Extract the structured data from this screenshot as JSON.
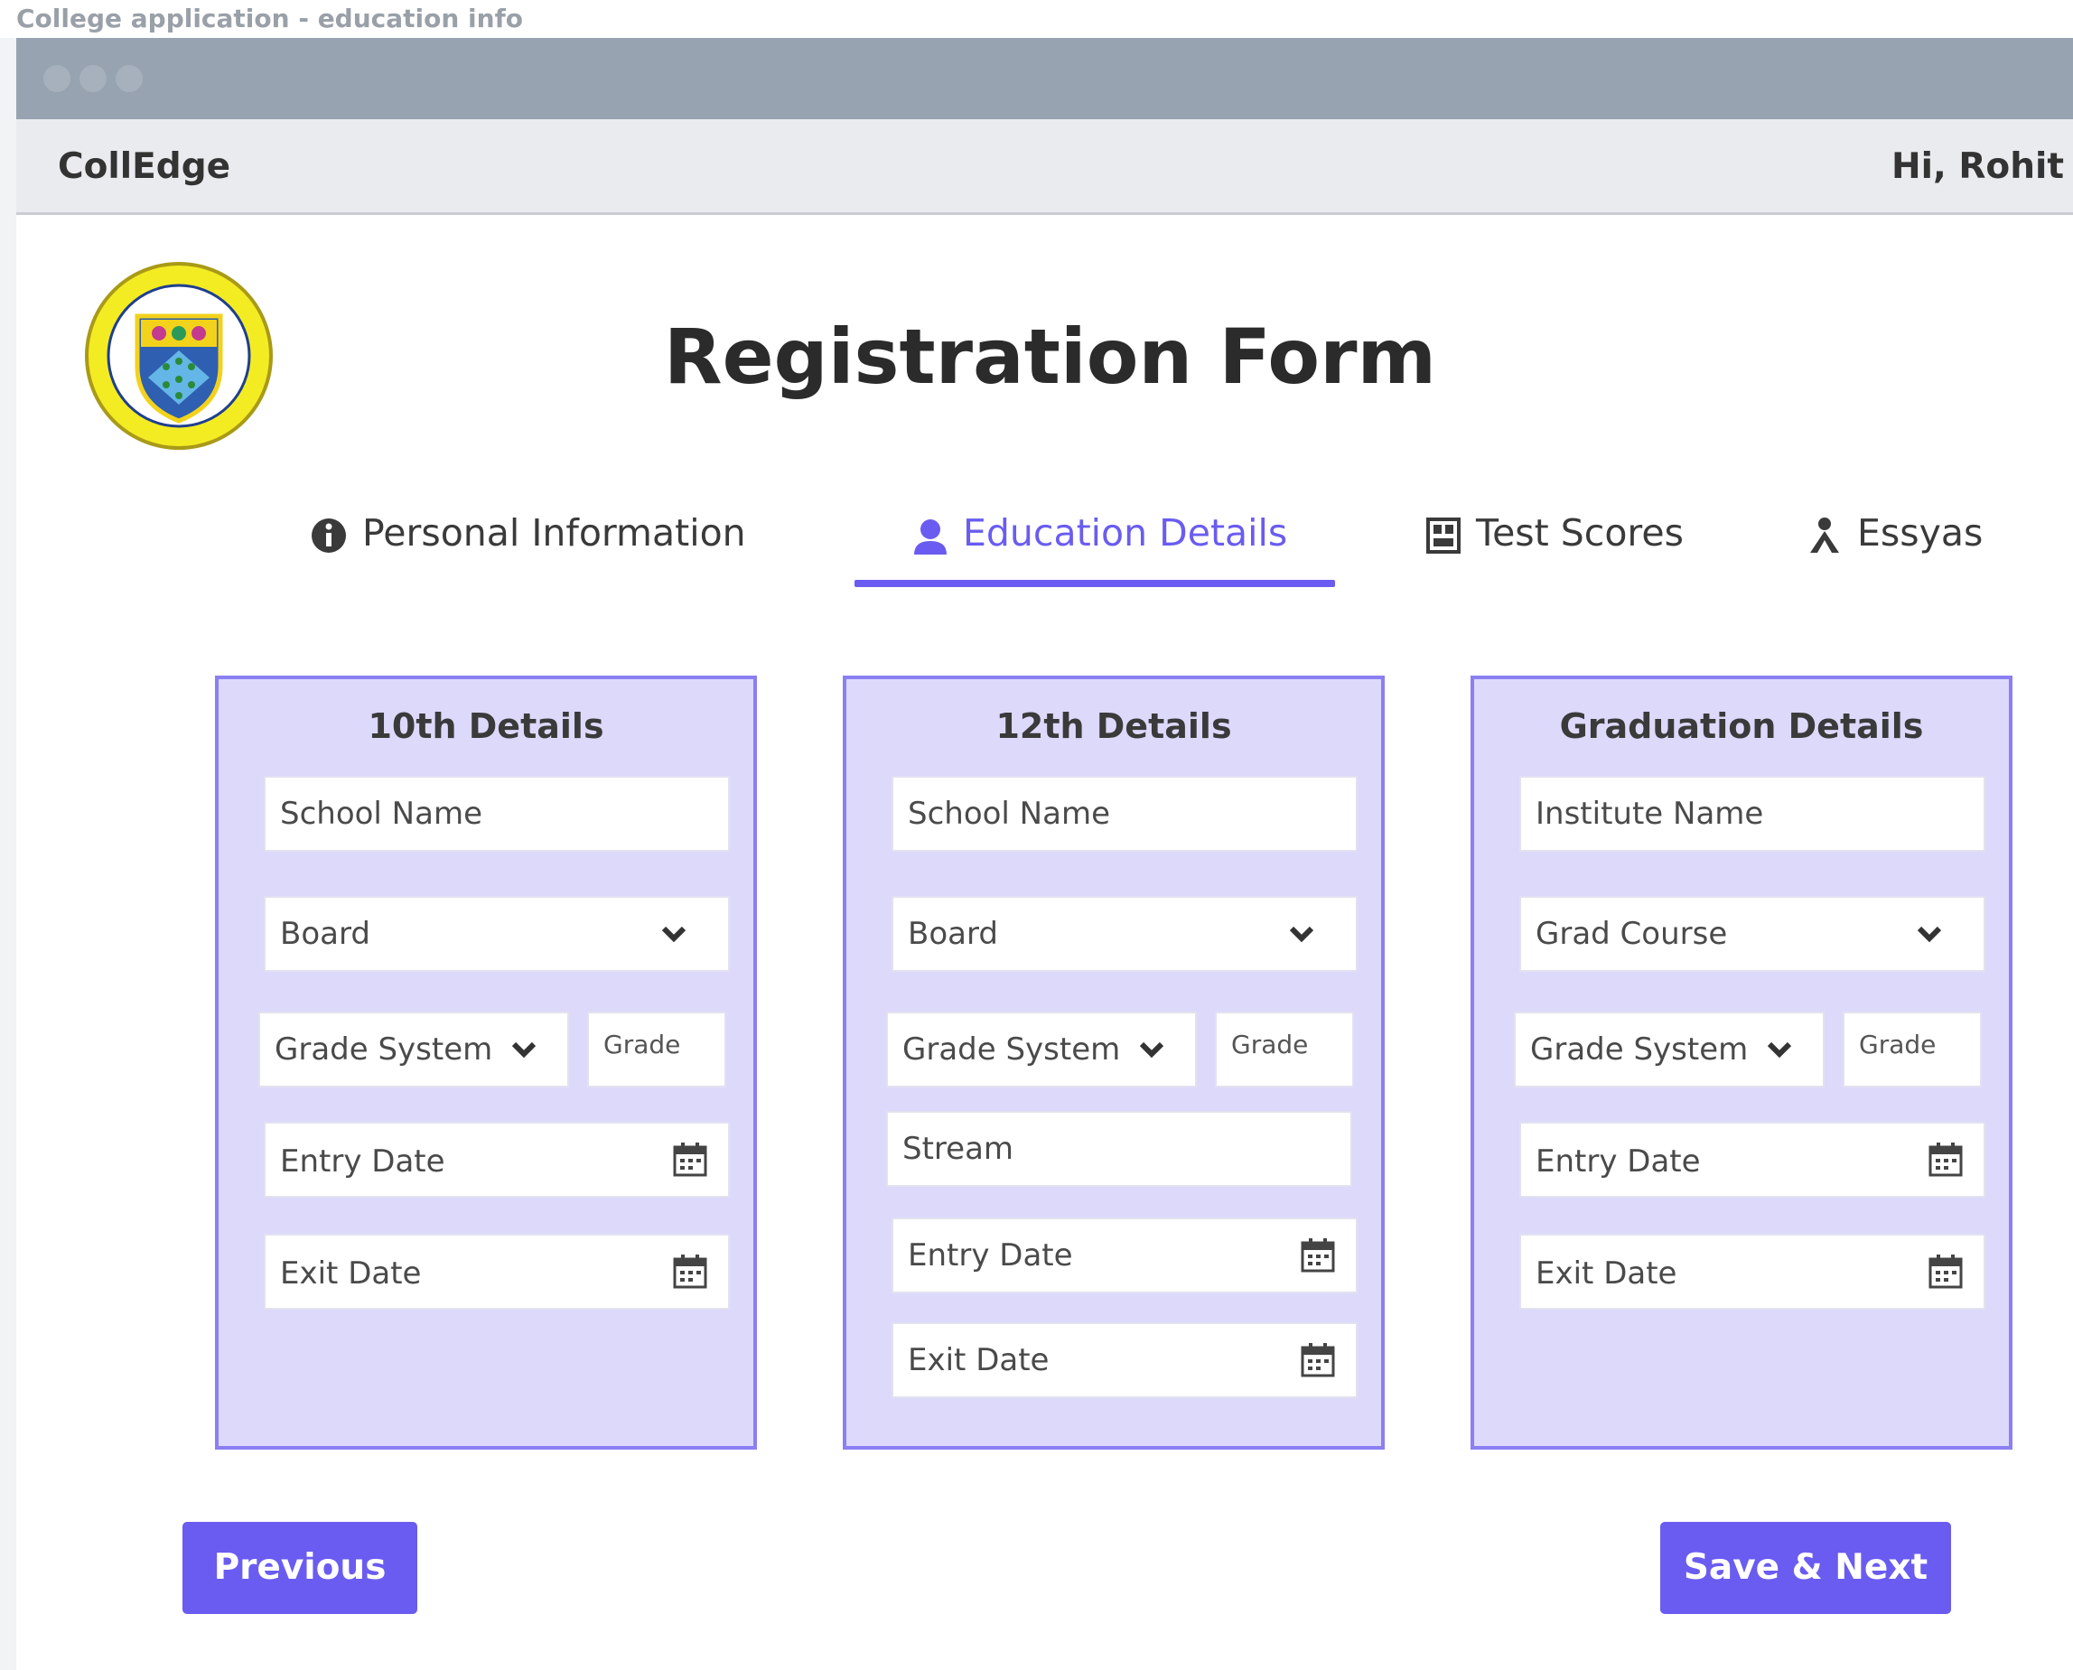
{
  "window": {
    "caption": "College application - education info"
  },
  "header": {
    "brand": "CollEdge",
    "greeting": "Hi, Rohit"
  },
  "page": {
    "title": "Registration Form"
  },
  "tabs": [
    {
      "label": "Personal Information",
      "icon": "info-icon"
    },
    {
      "label": "Education Details",
      "icon": "graduate-icon",
      "active": true
    },
    {
      "label": "Test Scores",
      "icon": "scorecard-icon"
    },
    {
      "label": "Essyas",
      "icon": "writer-icon"
    }
  ],
  "colors": {
    "accent": "#6a5cf0",
    "card_bg": "#dcd9fb",
    "card_border": "#8b7ff2"
  },
  "cards": {
    "tenth": {
      "title": "10th Details",
      "school": "School Name",
      "board": "Board",
      "grade_system": "Grade System",
      "grade": "Grade",
      "entry": "Entry Date",
      "exit": "Exit Date"
    },
    "twelfth": {
      "title": "12th Details",
      "school": "School Name",
      "board": "Board",
      "grade_system": "Grade System",
      "grade": "Grade",
      "stream": "Stream",
      "entry": "Entry Date",
      "exit": "Exit Date"
    },
    "grad": {
      "title": "Graduation Details",
      "institute": "Institute Name",
      "course": "Grad Course",
      "grade_system": "Grade System",
      "grade": "Grade",
      "entry": "Entry Date",
      "exit": "Exit Date"
    }
  },
  "buttons": {
    "previous": "Previous",
    "save_next": "Save & Next"
  }
}
